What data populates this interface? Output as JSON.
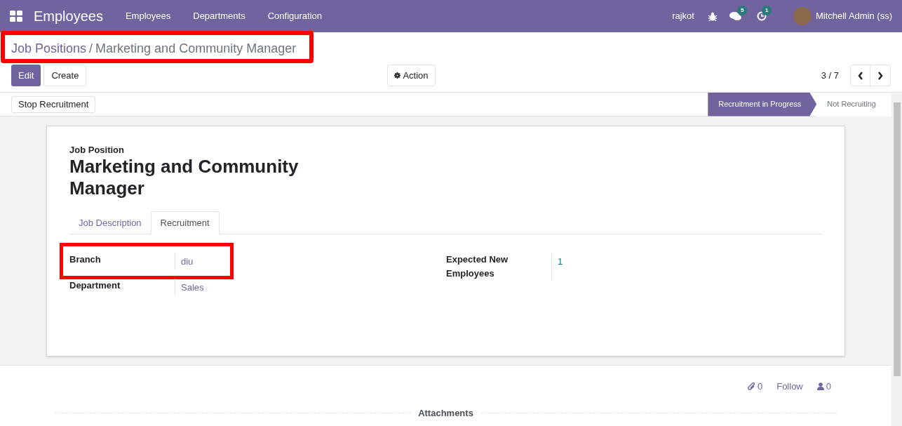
{
  "navbar": {
    "app_title": "Employees",
    "menu": [
      "Employees",
      "Departments",
      "Configuration"
    ],
    "company": "rajkot",
    "messages_count": "5",
    "activities_count": "1",
    "user": "Mitchell Admin (ss)"
  },
  "breadcrumb": {
    "parent": "Job Positions",
    "separator": "/",
    "current": "Marketing and Community Manager",
    "highlighted": true
  },
  "buttons": {
    "edit": "Edit",
    "create": "Create",
    "action": "Action"
  },
  "pager": {
    "value": "3 / 7"
  },
  "header_button": "Stop Recruitment",
  "stages": [
    {
      "label": "Recruitment in Progress",
      "selected": true
    },
    {
      "label": "Not Recruiting",
      "selected": false
    }
  ],
  "form": {
    "caption": "Job Position",
    "title": "Marketing and Community Manager",
    "tabs": [
      {
        "label": "Job Description",
        "selected": false
      },
      {
        "label": "Recruitment",
        "selected": true
      }
    ],
    "left_fields": [
      {
        "label": "Branch",
        "value": "diu",
        "highlighted": true
      },
      {
        "label": "Department",
        "value": "Sales",
        "highlighted": false
      }
    ],
    "right_fields": [
      {
        "label": "Expected New Employees",
        "value": "1"
      }
    ]
  },
  "chatter": {
    "attachments_count": "0",
    "follow": "Follow",
    "followers_count": "0",
    "section": "Attachments"
  }
}
